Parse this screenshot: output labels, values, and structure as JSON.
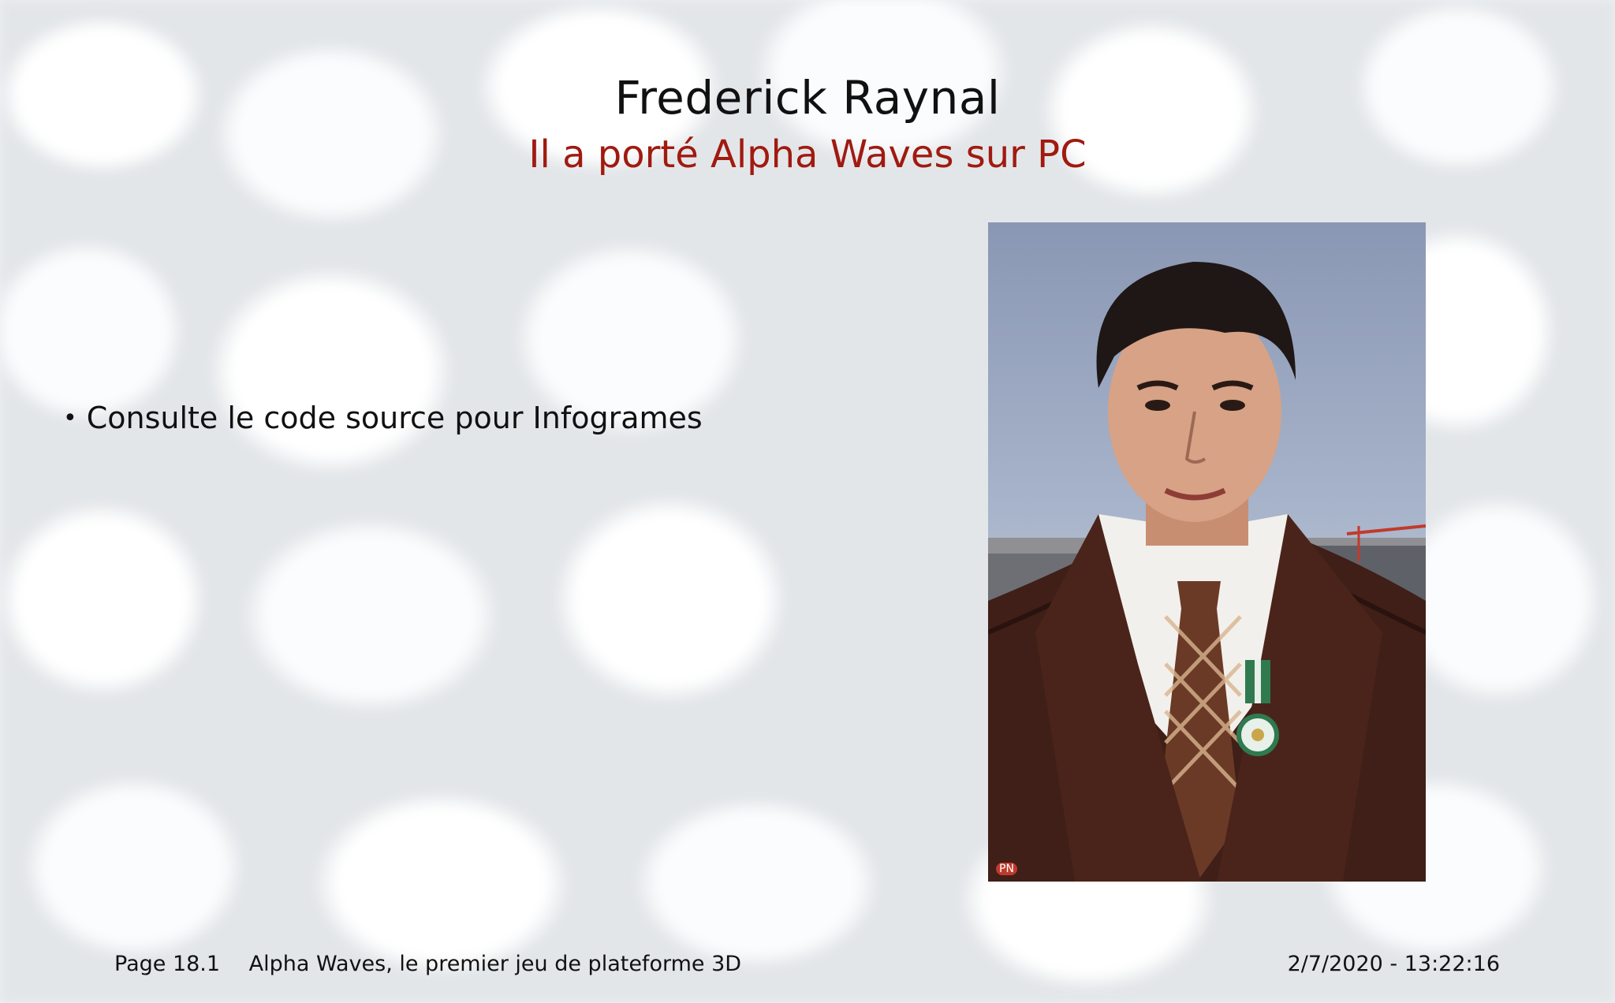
{
  "slide": {
    "title": "Frederick Raynal",
    "subtitle": "Il a porté Alpha Waves sur PC",
    "bullets": [
      "Consulte le code source pour Infogrames"
    ],
    "photo": {
      "watermark": "PN"
    }
  },
  "footer": {
    "page": "Page 18.1",
    "doc_title": "Alpha Waves, le premier jeu de plateforme 3D",
    "timestamp": "2/7/2020 - 13:22:16"
  },
  "colors": {
    "title": "#111111",
    "subtitle": "#a01a10",
    "background": "#eef0f3"
  }
}
